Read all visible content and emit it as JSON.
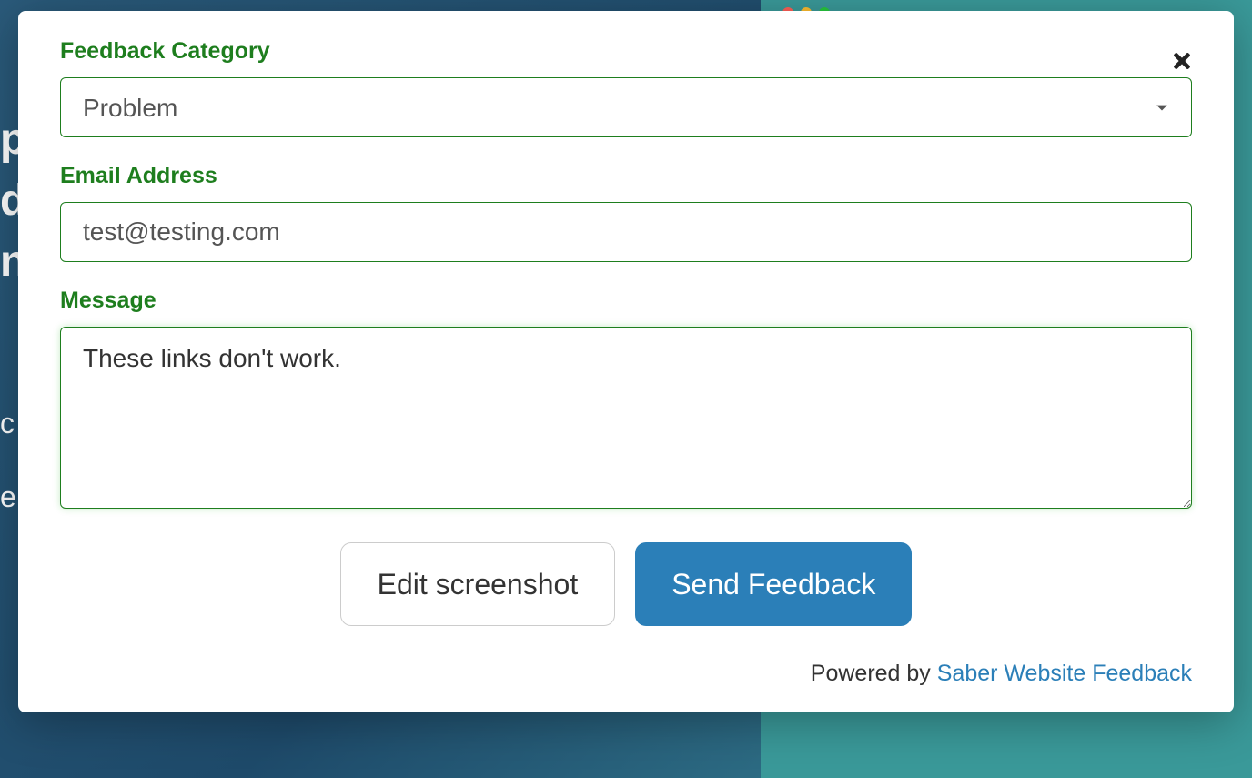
{
  "background": {
    "text_fragments": [
      "p",
      "d",
      "n"
    ],
    "small_fragments": [
      "c",
      "e"
    ]
  },
  "modal": {
    "category": {
      "label": "Feedback Category",
      "value": "Problem"
    },
    "email": {
      "label": "Email Address",
      "value": "test@testing.com"
    },
    "message": {
      "label": "Message",
      "value": "These links don't work."
    },
    "buttons": {
      "edit_screenshot": "Edit screenshot",
      "send_feedback": "Send Feedback"
    },
    "footer": {
      "powered_by": "Powered by ",
      "link_text": "Saber Website Feedback"
    }
  }
}
